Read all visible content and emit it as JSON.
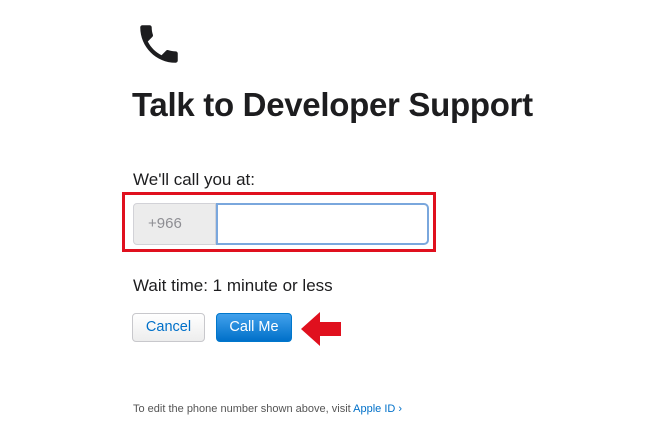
{
  "header": {
    "icon": "phone-icon",
    "title": "Talk to Developer Support"
  },
  "form": {
    "call_label": "We'll call you at:",
    "country_code": "+966",
    "phone_value": "",
    "wait_time": "Wait time: 1 minute or less",
    "cancel_label": "Cancel",
    "call_me_label": "Call Me"
  },
  "footer": {
    "note": "To edit the phone number shown above, visit ",
    "link_label": "Apple ID",
    "link_chevron": "›"
  },
  "colors": {
    "accent": "#0070c9",
    "highlight": "#e0101e",
    "arrow": "#e0101e"
  }
}
